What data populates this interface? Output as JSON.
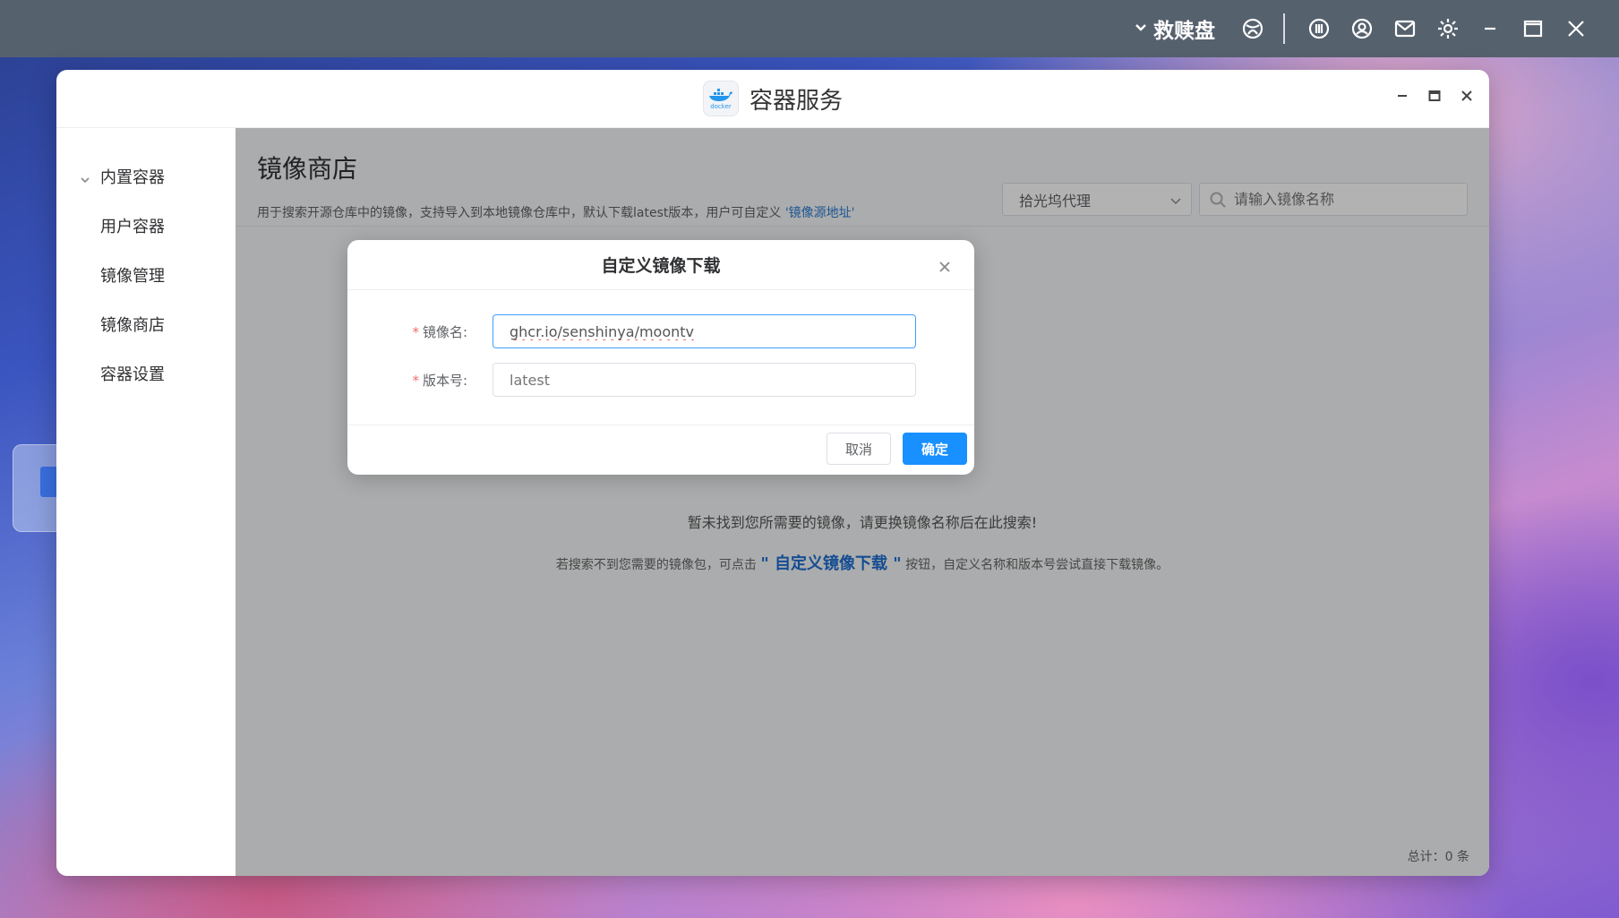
{
  "system_bar": {
    "username": "救赎盘",
    "icons": [
      "network-icon",
      "chip-icon",
      "user-icon",
      "mail-icon",
      "gear-icon"
    ]
  },
  "window": {
    "title": "容器服务",
    "logo_text": "docker"
  },
  "sidebar": {
    "items": [
      {
        "label": "内置容器"
      },
      {
        "label": "用户容器"
      },
      {
        "label": "镜像管理"
      },
      {
        "label": "镜像商店"
      },
      {
        "label": "容器设置"
      }
    ]
  },
  "main": {
    "title": "镜像商店",
    "description": "用于搜索开源仓库中的镜像，支持导入到本地镜像仓库中，默认下载latest版本，用户可自定义",
    "description_link": "'镜像源地址'",
    "proxy_select": "拾光坞代理",
    "search_placeholder": "请输入镜像名称",
    "empty_message": "暂未找到您所需要的镜像，请更换镜像名称后在此搜索!",
    "hint_prefix": "若搜索不到您需要的镜像包，可点击",
    "hint_link": "\" 自定义镜像下载 \"",
    "hint_suffix": "按钮，自定义名称和版本号尝试直接下载镜像。",
    "total": "总计：0 条"
  },
  "dialog": {
    "title": "自定义镜像下载",
    "image_name_label": "镜像名:",
    "image_name_value": "ghcr.io/senshinya/moontv",
    "version_label": "版本号:",
    "version_placeholder": "latest",
    "required_mark": "*",
    "cancel_label": "取消",
    "confirm_label": "确定"
  },
  "colors": {
    "primary": "#1890ff",
    "link": "#2b7cd3",
    "required": "#f56c6c",
    "system_bar": "#56616e"
  }
}
